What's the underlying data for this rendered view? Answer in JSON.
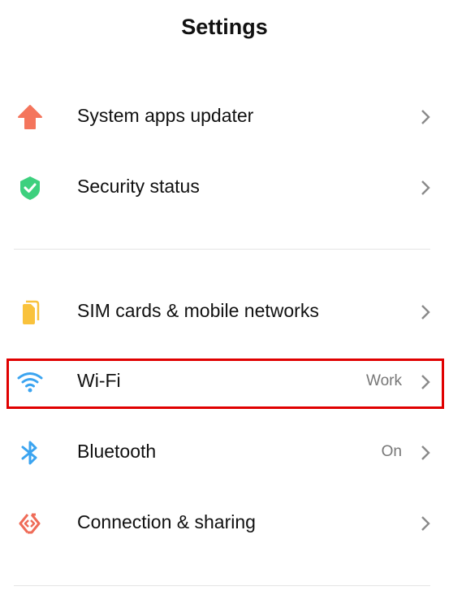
{
  "header": {
    "title": "Settings"
  },
  "sections": [
    {
      "items": [
        {
          "id": "system-apps-updater",
          "label": "System apps updater",
          "value": "",
          "icon": "arrow-up-icon",
          "icon_color": "#f4755c"
        },
        {
          "id": "security-status",
          "label": "Security status",
          "value": "",
          "icon": "shield-check-icon",
          "icon_color": "#3dd07e"
        }
      ]
    },
    {
      "items": [
        {
          "id": "sim-cards",
          "label": "SIM cards & mobile networks",
          "value": "",
          "icon": "sim-cards-icon",
          "icon_color": "#f9c23c"
        },
        {
          "id": "wifi",
          "label": "Wi-Fi",
          "value": "Work",
          "icon": "wifi-icon",
          "icon_color": "#3ba4f0",
          "highlighted": true
        },
        {
          "id": "bluetooth",
          "label": "Bluetooth",
          "value": "On",
          "icon": "bluetooth-icon",
          "icon_color": "#3ba4f0"
        },
        {
          "id": "connection-sharing",
          "label": "Connection & sharing",
          "value": "",
          "icon": "connection-sharing-icon",
          "icon_color": "#ef6b57"
        }
      ]
    }
  ],
  "colors": {
    "highlight": "#e00000",
    "chevron": "#8a8a8a",
    "value_text": "#777777"
  }
}
